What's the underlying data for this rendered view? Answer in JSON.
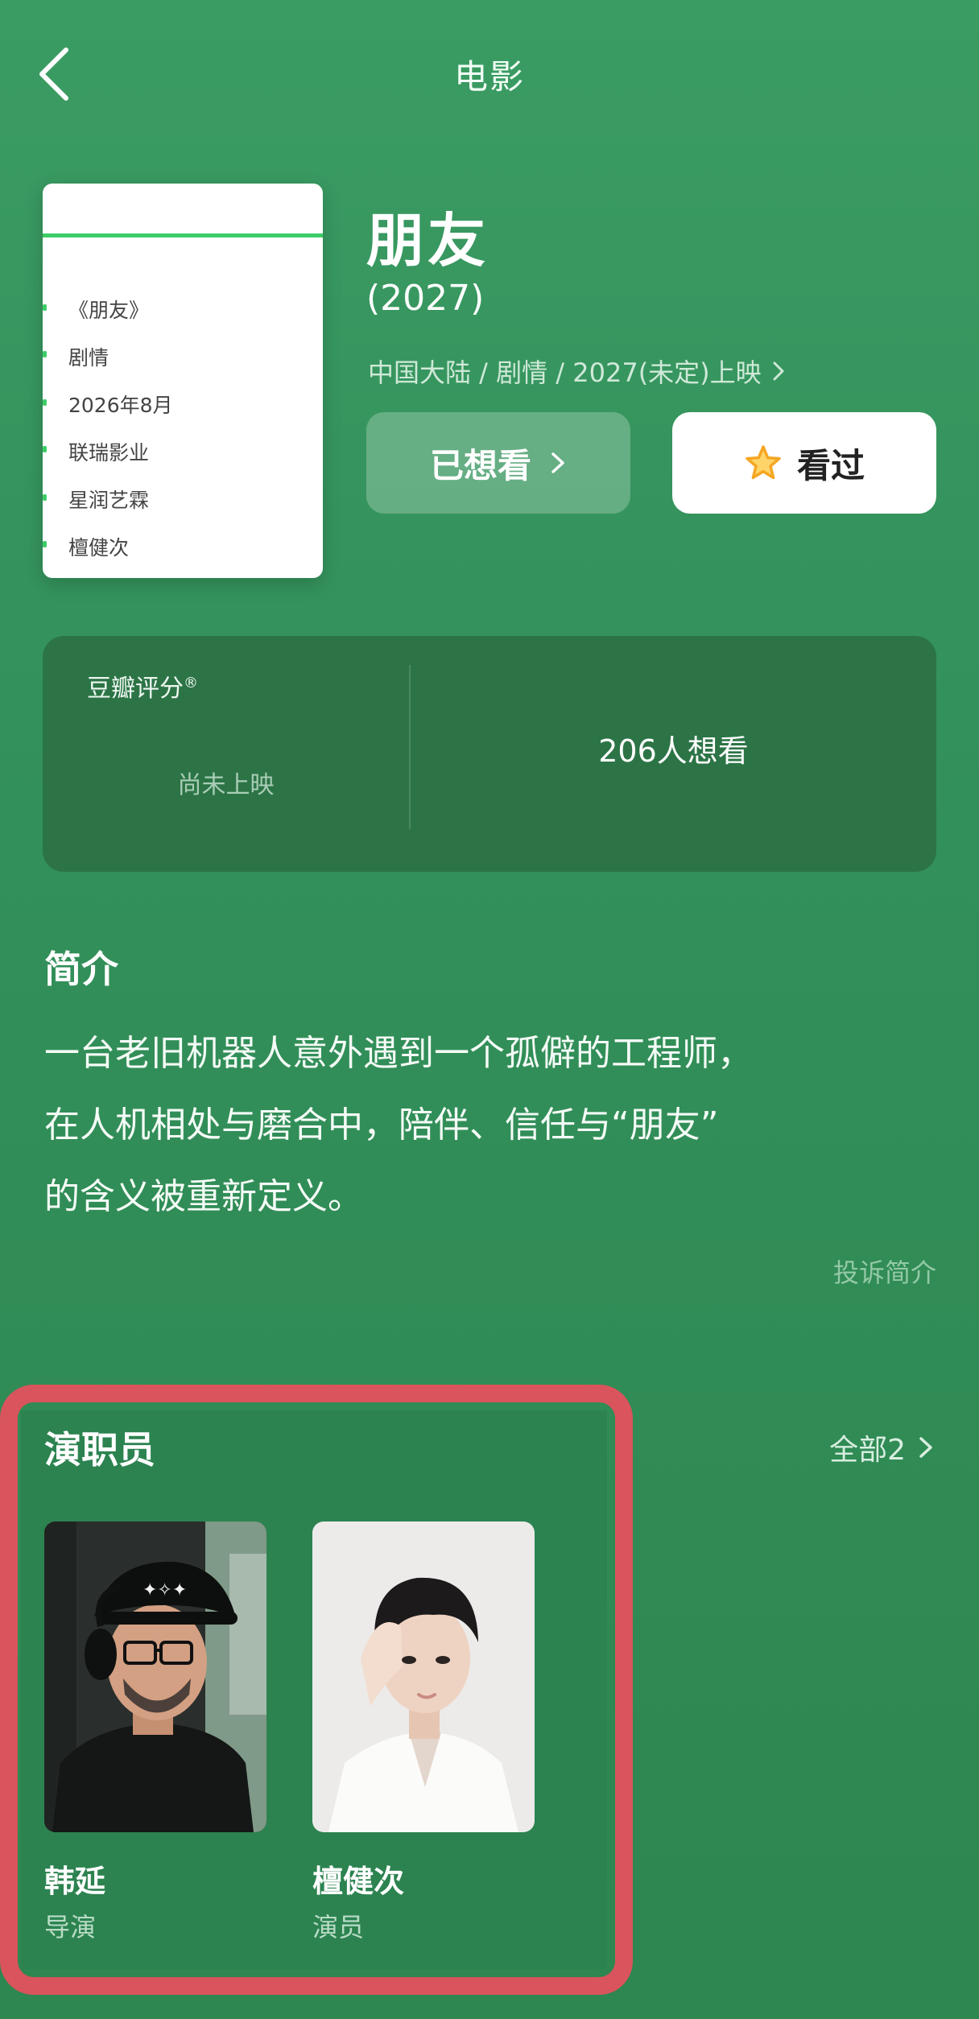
{
  "header": {
    "title": "电影"
  },
  "poster": {
    "items": [
      "《朋友》",
      "剧情",
      "2026年8月",
      "联瑞影业",
      "星润艺霖",
      "檀健次"
    ]
  },
  "movie": {
    "title": "朋友",
    "year": "(2027)",
    "meta": "中国大陆 / 剧情 / 2027(未定)上映",
    "want_label": "已想看",
    "seen_label": "看过"
  },
  "rating": {
    "label": "豆瓣评分",
    "registered": "®",
    "status": "尚未上映",
    "wants": "206人想看"
  },
  "synopsis": {
    "title": "简介",
    "lines": [
      "一台老旧机器人意外遇到一个孤僻的工程师，",
      "在人机相处与磨合中，陪伴、信任与“朋友”",
      "的含义被重新定义。"
    ],
    "report": "投诉简介"
  },
  "cast": {
    "title": "演职员",
    "all": "全部2",
    "members": [
      {
        "name": "韩延",
        "role": "导演"
      },
      {
        "name": "檀健次",
        "role": "演员"
      }
    ]
  },
  "colors": {
    "accent": "#3ccd66",
    "highlight": "#d9545c",
    "star": "#f5a623"
  }
}
